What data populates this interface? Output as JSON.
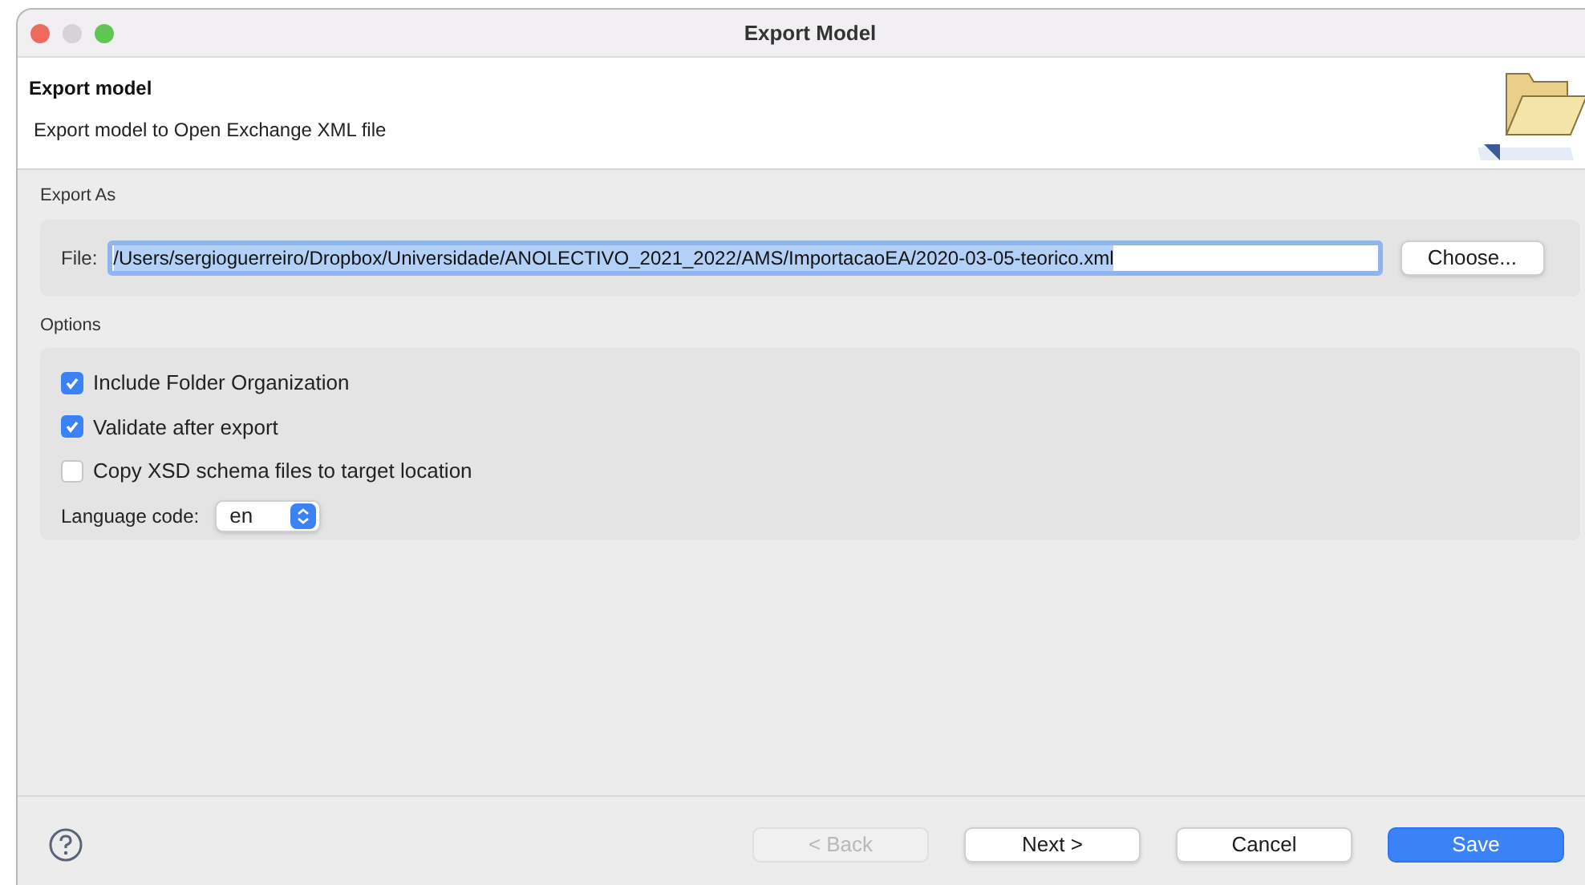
{
  "window": {
    "title": "Export Model"
  },
  "header": {
    "title": "Export model",
    "description": "Export model to Open Exchange XML file"
  },
  "export_as": {
    "label": "Export As",
    "file_label": "File:",
    "file_value": "/Users/sergioguerreiro/Dropbox/Universidade/ANOLECTIVO_2021_2022/AMS/ImportacaoEA/2020-03-05-teorico.xml",
    "text_selected": true,
    "choose_button": "Choose..."
  },
  "options": {
    "label": "Options",
    "checkboxes": [
      {
        "label": "Include Folder Organization",
        "checked": true
      },
      {
        "label": "Validate after export",
        "checked": true
      },
      {
        "label": "Copy XSD schema files to target location",
        "checked": false
      }
    ],
    "language_label": "Language code:",
    "language_value": "en"
  },
  "footer": {
    "buttons": [
      {
        "label": "< Back",
        "kind": "normal",
        "disabled": true
      },
      {
        "label": "Next >",
        "kind": "normal",
        "disabled": false
      },
      {
        "label": "Cancel",
        "kind": "normal",
        "disabled": false
      },
      {
        "label": "Save",
        "kind": "primary",
        "disabled": false
      }
    ]
  }
}
